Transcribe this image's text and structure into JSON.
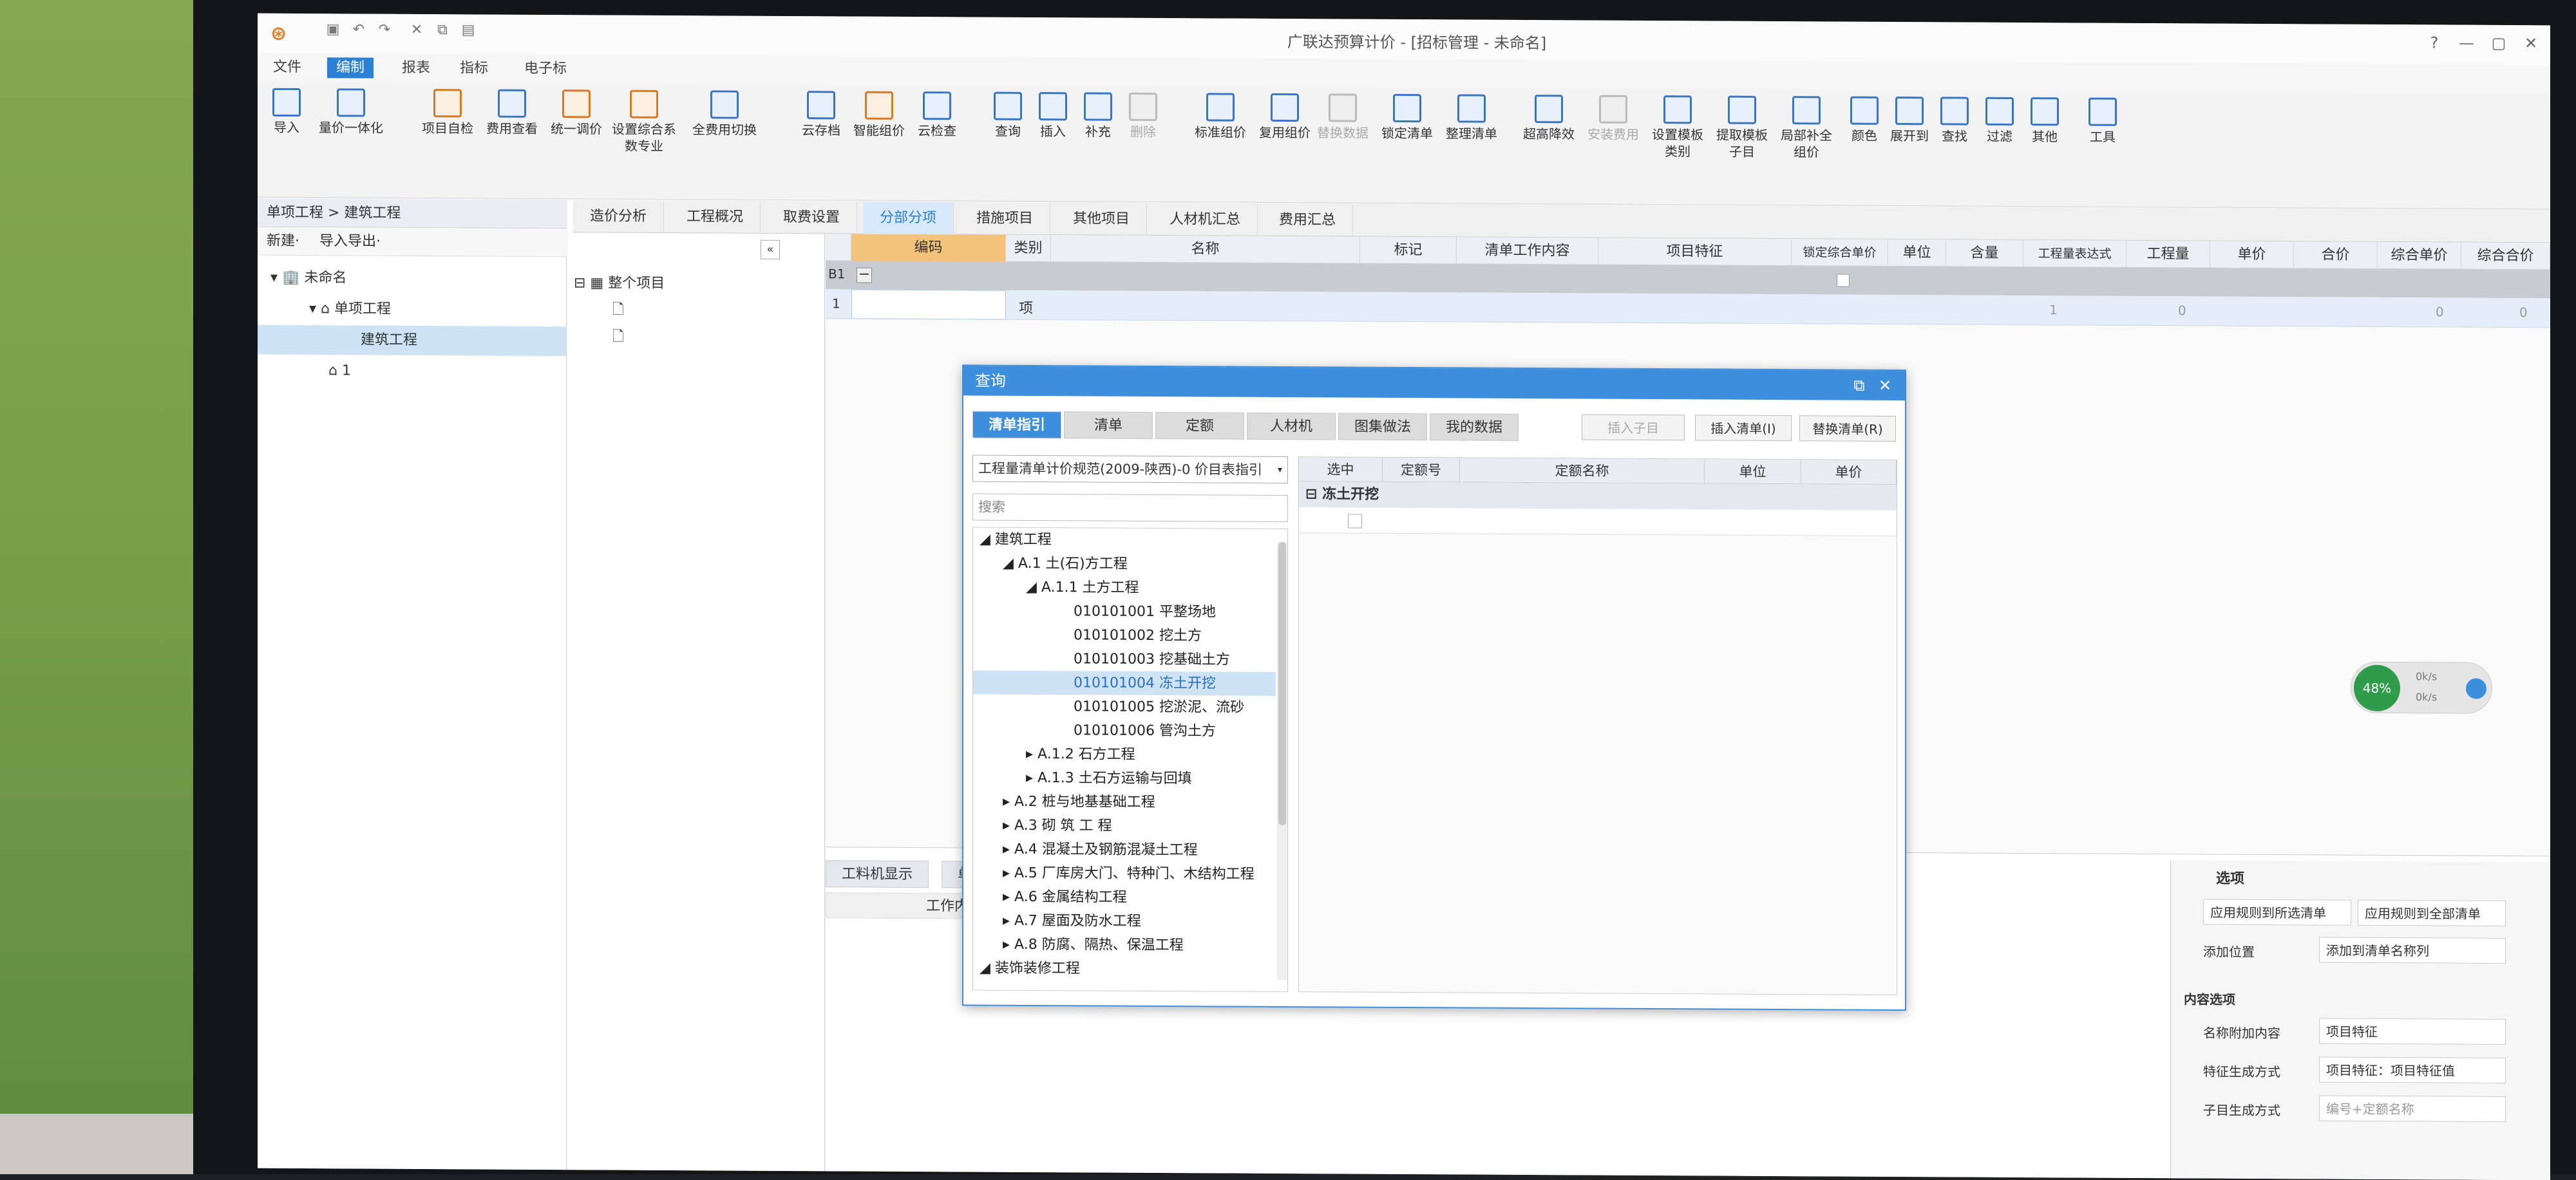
{
  "app": {
    "title": "广联达预算计价 - [招标管理 - 未命名]",
    "logo": "glodon-logo"
  },
  "menu": [
    "文件",
    "编制",
    "报表",
    "指标",
    "电子标"
  ],
  "menu_active": "编制",
  "ribbon": [
    "导入",
    "量价一体化",
    "项目自检",
    "费用查看",
    "统一调价",
    "设置综合系数专业",
    "全费用切换",
    "云存档",
    "智能组价",
    "云检查",
    "查询",
    "插入",
    "补充",
    "删除",
    "标准组价",
    "复用组价",
    "替换数据",
    "锁定清单",
    "整理清单",
    "超高降效",
    "安装费用",
    "设置模板类别",
    "提取模板子目",
    "局部补全组价",
    "颜色",
    "展开到",
    "查找",
    "过滤",
    "其他",
    "工具"
  ],
  "left": {
    "header": "单项工程 > 建筑工程",
    "tools": [
      "新建·",
      "导入导出·"
    ],
    "tree": [
      {
        "label": "未命名"
      },
      {
        "label": "单项工程"
      },
      {
        "label": "建筑工程"
      },
      {
        "label": "1"
      }
    ]
  },
  "mid": {
    "root": "整个项目"
  },
  "tabs": [
    "造价分析",
    "工程概况",
    "取费设置",
    "分部分项",
    "措施项目",
    "其他项目",
    "人材机汇总",
    "费用汇总"
  ],
  "tabs_active": "分部分项",
  "grid": {
    "headers": [
      "编码",
      "类别",
      "名称",
      "标记",
      "清单工作内容",
      "项目特征",
      "锁定综合单价",
      "单位",
      "含量",
      "工程量表达式",
      "工程量",
      "单价",
      "合价",
      "综合单价",
      "综合合价"
    ],
    "row_b1": "B1",
    "row1_no": "1",
    "row1_type": "项",
    "row1_values": [
      "1",
      "0",
      "0",
      "0"
    ]
  },
  "bottom": {
    "tabs": [
      "工料机显示",
      "单价"
    ],
    "work_content": "工作内容"
  },
  "right_options": {
    "title": "选项",
    "btn1": "应用规则到所选清单",
    "btn2": "应用规则到全部清单",
    "add_pos_label": "添加位置",
    "add_pos_value": "添加到清单名称列",
    "section": "内容选项",
    "name_add_label": "名称附加内容",
    "name_add_value": "项目特征",
    "feature_label": "特征生成方式",
    "feature_value": "项目特征：项目特征值",
    "sub_label": "子目生成方式",
    "sub_value": "编号+定额名称"
  },
  "badge": {
    "value": "48%",
    "up": "0k/s",
    "down": "0k/s"
  },
  "dialog": {
    "title": "查询",
    "tabs": [
      "清单指引",
      "清单",
      "定额",
      "人材机",
      "图集做法",
      "我的数据"
    ],
    "tabs_active": "清单指引",
    "buttons": [
      "插入子目",
      "插入清单(I)",
      "替换清单(R)"
    ],
    "norm_select": "工程量清单计价规范(2009-陕西)-0 价目表指引",
    "search_placeholder": "搜索",
    "tree": [
      {
        "label": "建筑工程",
        "level": 0
      },
      {
        "label": "A.1  土(石)方工程",
        "level": 1
      },
      {
        "label": "A.1.1  土方工程",
        "level": 2
      },
      {
        "label": "010101001  平整场地",
        "level": 3
      },
      {
        "label": "010101002  挖土方",
        "level": 3
      },
      {
        "label": "010101003  挖基础土方",
        "level": 3
      },
      {
        "label": "010101004  冻土开挖",
        "level": 3,
        "selected": true
      },
      {
        "label": "010101005  挖淤泥、流砂",
        "level": 3
      },
      {
        "label": "010101006  管沟土方",
        "level": 3
      },
      {
        "label": "A.1.2  石方工程",
        "level": 2
      },
      {
        "label": "A.1.3  土石方运输与回填",
        "level": 2
      },
      {
        "label": "A.2  桩与地基基础工程",
        "level": 1
      },
      {
        "label": "A.3  砌 筑 工 程",
        "level": 1
      },
      {
        "label": "A.4  混凝土及钢筋混凝土工程",
        "level": 1
      },
      {
        "label": "A.5  厂库房大门、特种门、木结构工程",
        "level": 1
      },
      {
        "label": "A.6  金属结构工程",
        "level": 1
      },
      {
        "label": "A.7  屋面及防水工程",
        "level": 1
      },
      {
        "label": "A.8  防腐、隔热、保温工程",
        "level": 1
      },
      {
        "label": "装饰装修工程",
        "level": 0
      }
    ],
    "grid_headers": [
      "选中",
      "定额号",
      "定额名称",
      "单位",
      "单价"
    ],
    "group": "冻土开挖"
  },
  "colors": {
    "accent": "#3e8ede",
    "menu_active": "#2a7fd6",
    "wall": "#7aa14a"
  }
}
